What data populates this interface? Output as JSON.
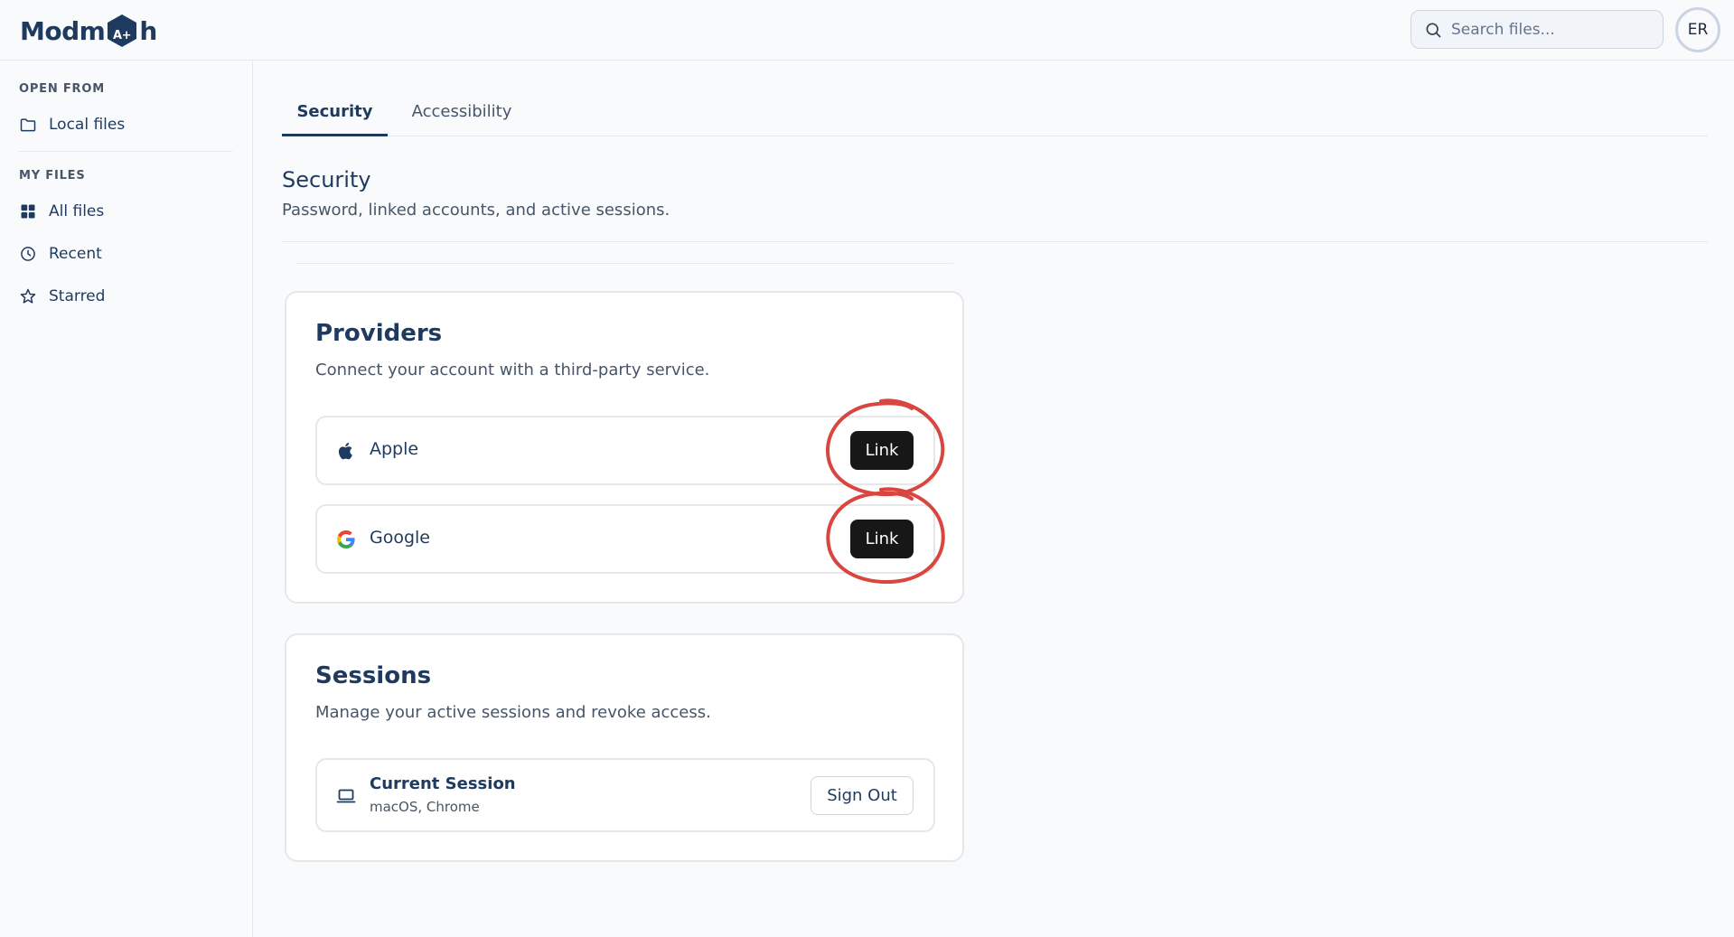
{
  "app": {
    "logo_text_before": "Modm",
    "logo_text_after": "h",
    "logo_hex_text": "A+"
  },
  "header": {
    "search_placeholder": "Search files...",
    "avatar_initials": "ER"
  },
  "sidebar": {
    "section_open": "OPEN FROM",
    "local_files": "Local files",
    "section_files": "MY FILES",
    "items": [
      {
        "label": "All files",
        "icon": "grid-icon"
      },
      {
        "label": "Recent",
        "icon": "clock-icon"
      },
      {
        "label": "Starred",
        "icon": "star-icon"
      }
    ]
  },
  "tabs": [
    {
      "label": "Security",
      "active": true
    },
    {
      "label": "Accessibility",
      "active": false
    }
  ],
  "page": {
    "title": "Security",
    "subtitle": "Password, linked accounts, and active sessions."
  },
  "providers": {
    "title": "Providers",
    "description": "Connect your account with a third-party service.",
    "items": [
      {
        "name": "Apple",
        "icon": "apple-icon",
        "action": "Link"
      },
      {
        "name": "Google",
        "icon": "google-icon",
        "action": "Link"
      }
    ]
  },
  "sessions": {
    "title": "Sessions",
    "description": "Manage your active sessions and revoke access.",
    "current": {
      "title": "Current Session",
      "meta": "macOS, Chrome",
      "action": "Sign Out",
      "icon": "laptop-icon"
    }
  },
  "colors": {
    "brand": "#1e3a5f",
    "button_dark": "#171717",
    "annotation": "#d9453f"
  }
}
